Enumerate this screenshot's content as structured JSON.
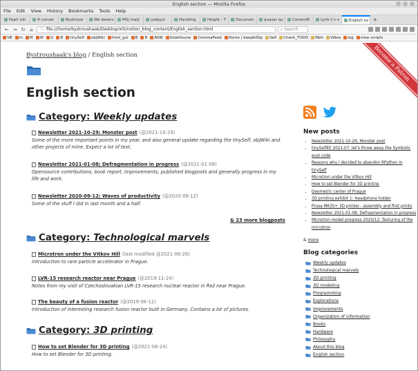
{
  "window": {
    "title": "English section — Mozilla Firefox"
  },
  "menu": [
    "File",
    "Edit",
    "View",
    "History",
    "Bookmarks",
    "Tools",
    "Help"
  ],
  "tabs": [
    "Papír toh",
    "A conver",
    "Bystrousi",
    "We deserv",
    "Můj malý",
    "justpy.k",
    "Handling",
    "Height - T",
    "Documen",
    "quasar qu",
    "ContentE",
    "Lyrik C++",
    "English se"
  ],
  "nav": {
    "url": "file:///home/bystroushaak/Desktop/xlit/notion_blog_content/English_section.html",
    "search_placeholder": "Search"
  },
  "bookmarks": [
    "VB",
    "m",
    "M",
    "W",
    "G",
    "B",
    "tinySelf",
    "objWiki",
    "html_gui",
    "B",
    "B",
    "AKW",
    "kitakitsune",
    "CommaFeed",
    "Home | beepb00p",
    "Self",
    "Check_TODO",
    "Meh",
    "Videa",
    "log",
    "view scripts"
  ],
  "page": {
    "ribbon": "Become a Patron",
    "breadcrumb_home": "Bystroushaak's blog",
    "breadcrumb_sep": " / ",
    "breadcrumb_current": "English section",
    "heading": "English section",
    "category_prefix": "Category: ",
    "categories": [
      {
        "name": "Weekly updates",
        "posts": [
          {
            "title": "Newsletter 2021-10-29; Monster post",
            "date": "(@2021-10-29)",
            "desc": "Some of the more important points in my year, and also general update regarding the tinySelf, objWiki and other projects of mine. Expect a lot of text."
          },
          {
            "title": "Newsletter 2021-01-08; Defragmentation in progress",
            "date": "(@2021-01-08)",
            "desc": "Opensource contributions, book report, improvements, published blogposts and generally progress in my life and work."
          },
          {
            "title": "Newsletter 2020-09-12; Waves of productivity",
            "date": "(@2020-09-12)",
            "desc": "Some of the stuff I did in last month and a half."
          }
        ],
        "more": "& 23 more blogposts"
      },
      {
        "name": "Technological marvels",
        "posts": [
          {
            "title": "Microtron under the Vítkov Hill",
            "date": "(last modified @2021-06-26)",
            "desc": "Introduction to rare particle accelerator in Prague."
          },
          {
            "title": "LVR-15 research reactor near Prague",
            "date": "(@2019-11-24)",
            "desc": "Notes from my visit of Czechoslovakian LVR-15 research nuclear reactor in Řež near Prague."
          },
          {
            "title": "The beauty of a fusion reactor",
            "date": "(@2019-06-12)",
            "desc": "Introduction of interesting research fusion reactor built in Germany. Contains a lot of pictures."
          }
        ]
      },
      {
        "name": "3D printing",
        "posts": [
          {
            "title": "How to set Blender for 3D printing",
            "date": "(@2021-06-24)",
            "desc": "How to set Blender for 3D printing."
          }
        ]
      }
    ]
  },
  "sidebar": {
    "new_posts_heading": "New posts",
    "new_posts": [
      "Newsletter 2021-10-29; Monster post",
      "tinySelfEE 2021-07: let's throw away the Symbolic eval code",
      "Reasons why I decided to abandon RPython in tinySelf",
      "Microtron under the Vítkov Hill",
      "How to set Blender for 3D printing",
      "Geometric center of Prague",
      "3D printing exhibit 1: Headphone holder",
      "Prusa MK3S+ 3D printer - assembly and first prints",
      "Newsletter 2021-01-08; Defragmentation in progress",
      "Microtron model progress 2020/12: Texturing of the microtron"
    ],
    "more_prefix": "& ",
    "more_link": "more",
    "categories_heading": "Blog categories",
    "categories": [
      "Weekly updates",
      "Technological marvels",
      "3D printing",
      "3D modeling",
      "Programming",
      "Explorations",
      "Improvements",
      "Organization of information",
      "Books",
      "Hardware",
      "Philosophy",
      "About this blog",
      "English section"
    ]
  },
  "colors": {
    "accent": "#0a84ff",
    "ribbon": "#d3363b",
    "folder": "#2f6db5",
    "rss": "#f48120",
    "twitter": "#1da1f2"
  }
}
